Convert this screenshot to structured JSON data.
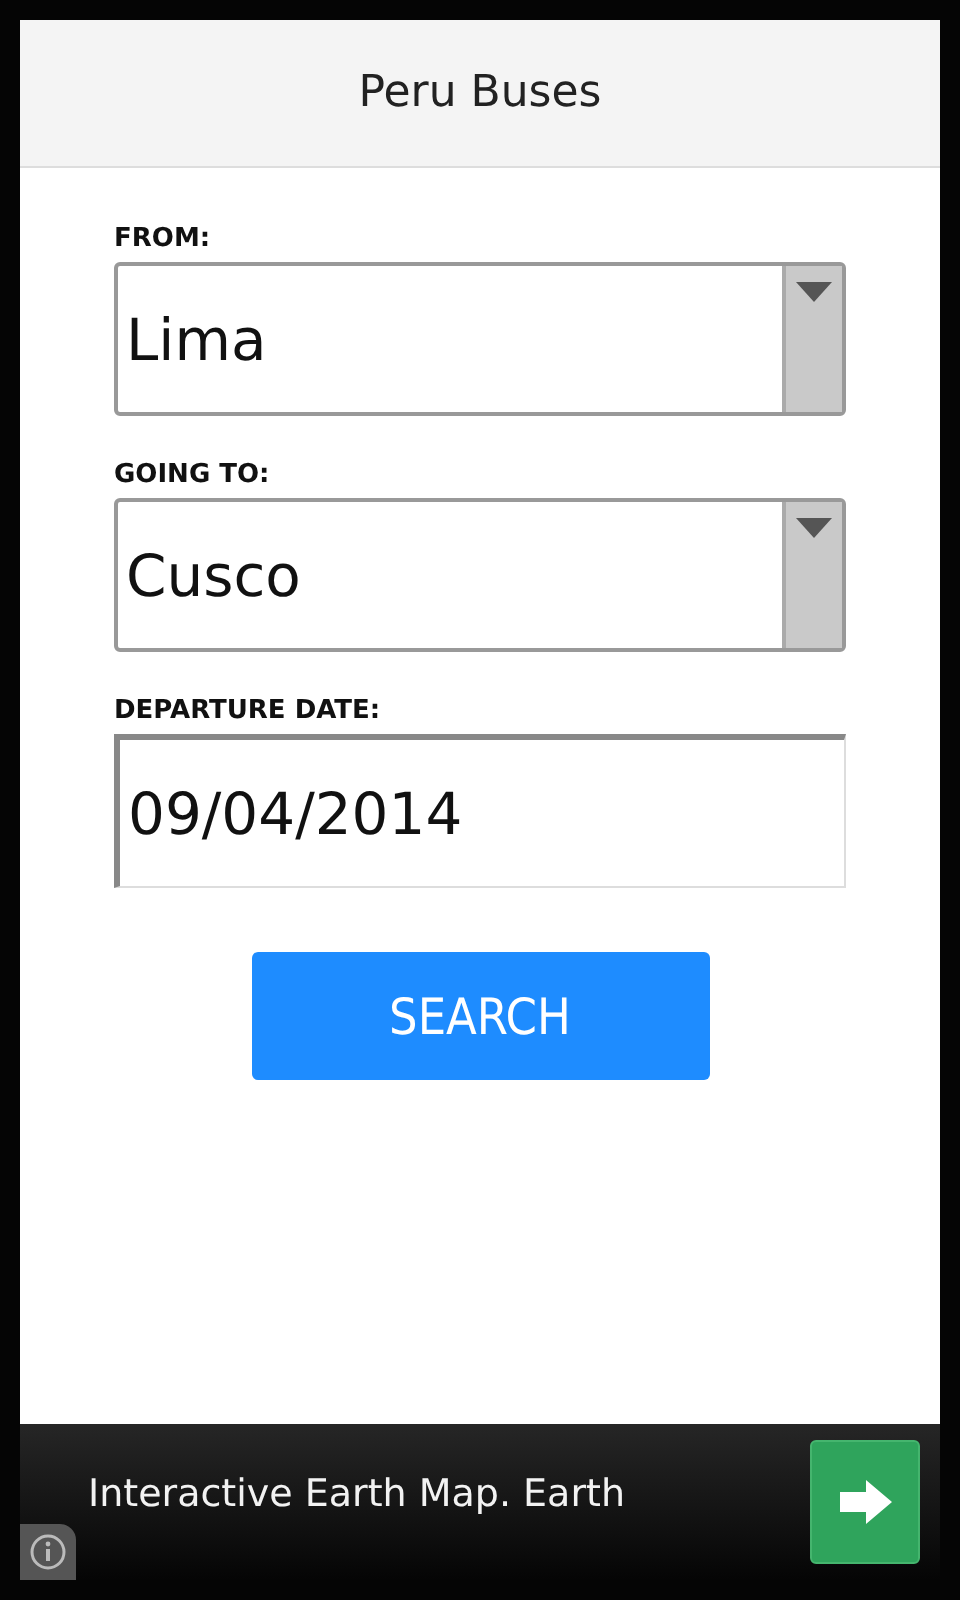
{
  "app_bar": {
    "title": "Peru Buses"
  },
  "fields": [
    {
      "kind": "select",
      "label": "FROM:",
      "value": "Lima"
    },
    {
      "kind": "select",
      "label": "GOING TO:",
      "value": "Cusco"
    },
    {
      "kind": "text",
      "label": "DEPARTURE DATE:",
      "value": "09/04/2014"
    }
  ],
  "search_button": {
    "label": "SEARCH"
  },
  "ad_banner": {
    "text": "Interactive Earth Map. Earth"
  }
}
